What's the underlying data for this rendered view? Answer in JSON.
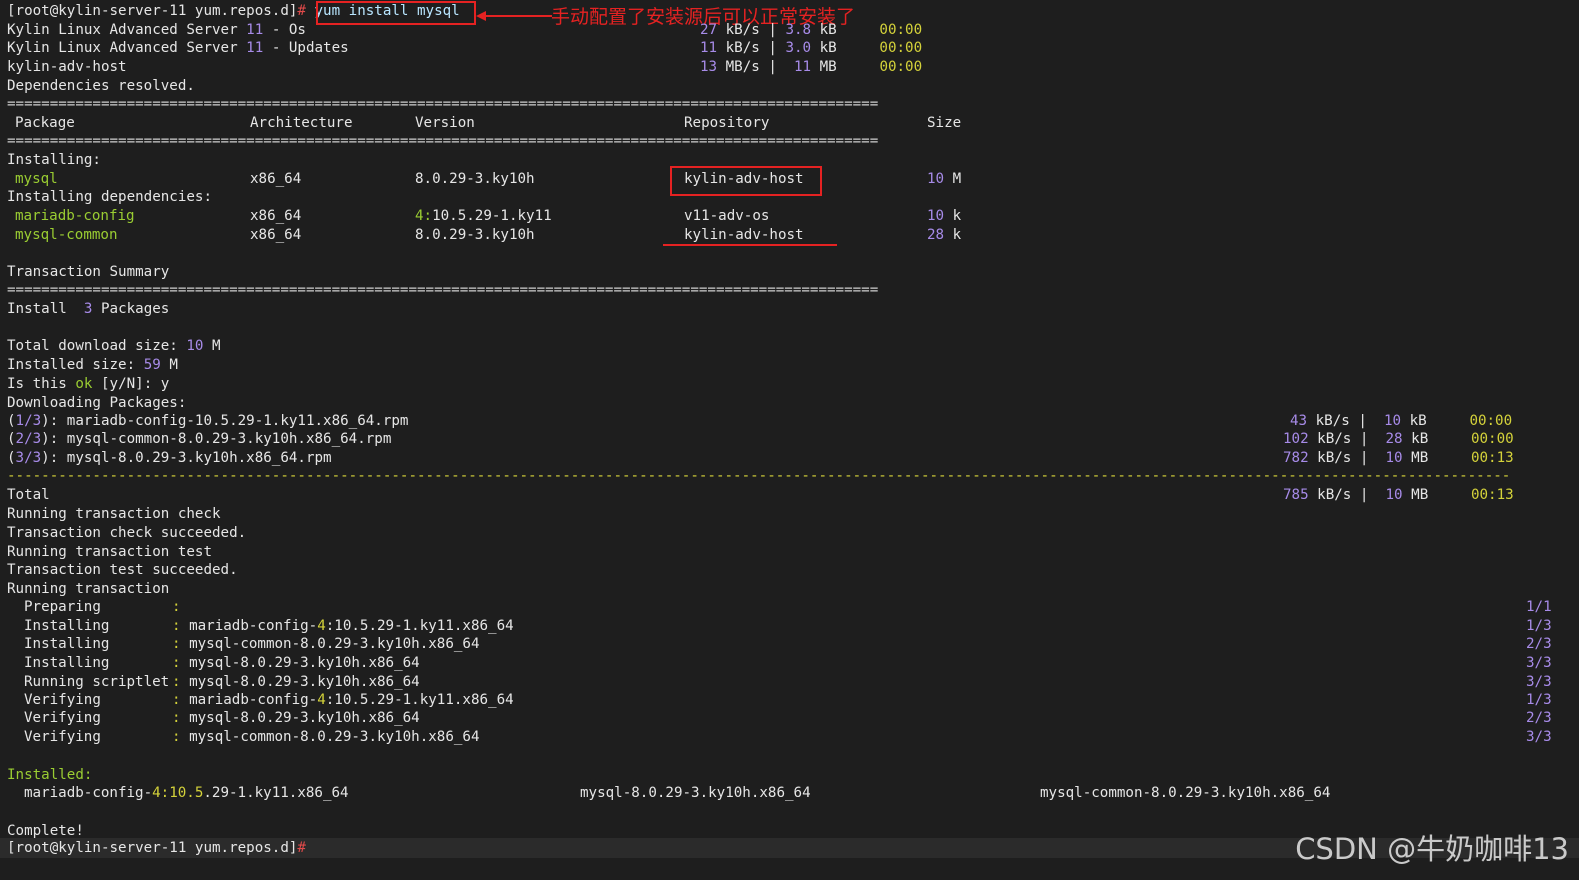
{
  "prompt": {
    "text": "[root@kylin-server-11 yum.repos.d]",
    "hash": "#",
    "command": "yum install mysql"
  },
  "annotation": "手动配置了安装源后可以正常安装了",
  "repos": [
    {
      "name": "Kylin Linux Advanced Server",
      "ver": "11",
      "sfx": "- Os",
      "speed": "27",
      "sunit": "kB/s",
      "size": "3.8",
      "szunit": "kB",
      "time": "00:00"
    },
    {
      "name": "Kylin Linux Advanced Server",
      "ver": "11",
      "sfx": "- Updates",
      "speed": "11",
      "sunit": "kB/s",
      "size": "3.0",
      "szunit": "kB",
      "time": "00:00"
    },
    {
      "name": "kylin-adv-host",
      "ver": "",
      "sfx": "",
      "speed": "13",
      "sunit": "MB/s",
      "size": "11",
      "szunit": "MB",
      "time": "00:00"
    }
  ],
  "deps_resolved": "Dependencies resolved.",
  "separator_double": "======================================================================================================",
  "separator_single": "--------------------------------------------------------------------------------------------------------------------------------------------------------------------------------",
  "table_headers": {
    "package": "Package",
    "arch": "Architecture",
    "version": "Version",
    "repo": "Repository",
    "size": "Size"
  },
  "installing_label": "Installing:",
  "installing_deps_label": "Installing dependencies:",
  "packages": [
    {
      "name": "mysql",
      "arch": "x86_64",
      "version": "8.0.29-3.ky10h",
      "repo": "kylin-adv-host",
      "size": "10",
      "unit": "M"
    },
    {
      "name": "mariadb-config",
      "arch": "x86_64",
      "version_epoch": "4",
      "version_rest": "10.5.29-1.ky11",
      "repo": "v11-adv-os",
      "size": "10",
      "unit": "k"
    },
    {
      "name": "mysql-common",
      "arch": "x86_64",
      "version": "8.0.29-3.ky10h",
      "repo": "kylin-adv-host",
      "size": "28",
      "unit": "k"
    }
  ],
  "transaction_summary": "Transaction Summary",
  "install_line": {
    "label": "Install",
    "count": "3",
    "word": "Packages"
  },
  "total_download": {
    "label": "Total download size",
    "value": "10",
    "unit": "M"
  },
  "installed_size": {
    "label": "Installed size",
    "value": "59",
    "unit": "M"
  },
  "confirm": {
    "pre": "Is this",
    "ok": "ok",
    "post": "[y/N]:",
    "answer": "y"
  },
  "downloading_label": "Downloading Packages:",
  "downloads": [
    {
      "idx": "1/3",
      "file": "mariadb-config-10.5.29-1.ky11.x86_64.rpm",
      "speed": "43",
      "sunit": "kB/s",
      "size": "10",
      "szunit": "kB",
      "time": "00:00"
    },
    {
      "idx": "2/3",
      "file": "mysql-common-8.0.29-3.ky10h.x86_64.rpm",
      "speed": "102",
      "sunit": "kB/s",
      "size": "28",
      "szunit": "kB",
      "time": "00:00"
    },
    {
      "idx": "3/3",
      "file": "mysql-8.0.29-3.ky10h.x86_64.rpm",
      "speed": "782",
      "sunit": "kB/s",
      "size": "10",
      "szunit": "MB",
      "time": "00:13"
    }
  ],
  "total": {
    "label": "Total",
    "speed": "785",
    "sunit": "kB/s",
    "size": "10",
    "szunit": "MB",
    "time": "00:13"
  },
  "status_lines": [
    "Running transaction check",
    "Transaction check succeeded.",
    "Running transaction test",
    "Transaction test succeeded.",
    "Running transaction"
  ],
  "steps": [
    {
      "action": "Preparing",
      "pkg": "",
      "count": "1/1"
    },
    {
      "action": "Installing",
      "pkg": "mariadb-config-",
      "epoch": "4",
      "rest": ":10.5.29-1.ky11.x86_64",
      "count": "1/3"
    },
    {
      "action": "Installing",
      "pkg": "mysql-common-8.0.29-3.ky10h.x86_64",
      "count": "2/3"
    },
    {
      "action": "Installing",
      "pkg": "mysql-8.0.29-3.ky10h.x86_64",
      "count": "3/3"
    },
    {
      "action": "Running scriptlet",
      "pkg": "mysql-8.0.29-3.ky10h.x86_64",
      "count": "3/3"
    },
    {
      "action": "Verifying",
      "pkg": "mariadb-config-",
      "epoch": "4",
      "rest": ":10.5.29-1.ky11.x86_64",
      "count": "1/3"
    },
    {
      "action": "Verifying",
      "pkg": "mysql-8.0.29-3.ky10h.x86_64",
      "count": "2/3"
    },
    {
      "action": "Verifying",
      "pkg": "mysql-common-8.0.29-3.ky10h.x86_64",
      "count": "3/3"
    }
  ],
  "installed_label": "Installed:",
  "installed": [
    {
      "pre": "mariadb-config-",
      "epoch": "4",
      "mid": ":",
      "v1": "10.5",
      "rest": ".29-1.ky11.x86_64"
    },
    {
      "text": "mysql-8.0.29-3.ky10h.x86_64"
    },
    {
      "text": "mysql-common-8.0.29-3.ky10h.x86_64"
    }
  ],
  "complete": "Complete!",
  "watermark": "CSDN @牛奶咖啡13"
}
